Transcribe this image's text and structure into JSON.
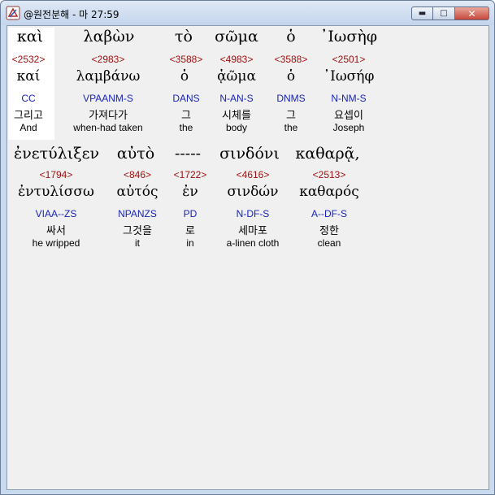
{
  "window": {
    "title": "@원전분해 - 마 27:59",
    "controls": {
      "minimize": "▬",
      "maximize": "□",
      "close": "✕"
    }
  },
  "rows": [
    {
      "greek": [
        "καὶ",
        "λαβὼν",
        "τὸ",
        "σῶμα",
        "ὁ",
        "᾿Ιωσὴφ"
      ],
      "strongs": [
        "<2532>",
        "<2983>",
        "<3588>",
        "<4983>",
        "<3588>",
        "<2501>"
      ],
      "lemma": [
        "καί",
        "λαμβάνω",
        "ὁ",
        "ᾀῶμα",
        "ὁ",
        "᾿Ιωσήφ"
      ],
      "morph": [
        "CC",
        "VPAANM-S",
        "DANS",
        "N-AN-S",
        "DNMS",
        "N-NM-S"
      ],
      "korean": [
        "그리고",
        "가져다가",
        "그",
        "시체를",
        "그",
        "요셉이"
      ],
      "english": [
        "And",
        "when-had taken",
        "the",
        "body",
        "the",
        "Joseph"
      ]
    },
    {
      "greek": [
        "ἐνετύλιξεν",
        "αὐτὸ",
        "-----",
        "σινδόνι",
        "καθαρᾷ,"
      ],
      "strongs": [
        "<1794>",
        "<846>",
        "<1722>",
        "<4616>",
        "<2513>"
      ],
      "lemma": [
        "ἐντυλίσσω",
        "αὐτός",
        "ἐν",
        "σινδών",
        "καθαρός"
      ],
      "morph": [
        "VIAA--ZS",
        "NPANZS",
        "PD",
        "N-DF-S",
        "A--DF-S"
      ],
      "korean": [
        "싸서",
        "그것을",
        "로",
        "세마포",
        "정한"
      ],
      "english": [
        "he wripped",
        "it",
        "in",
        "a-linen cloth",
        "clean"
      ]
    }
  ]
}
